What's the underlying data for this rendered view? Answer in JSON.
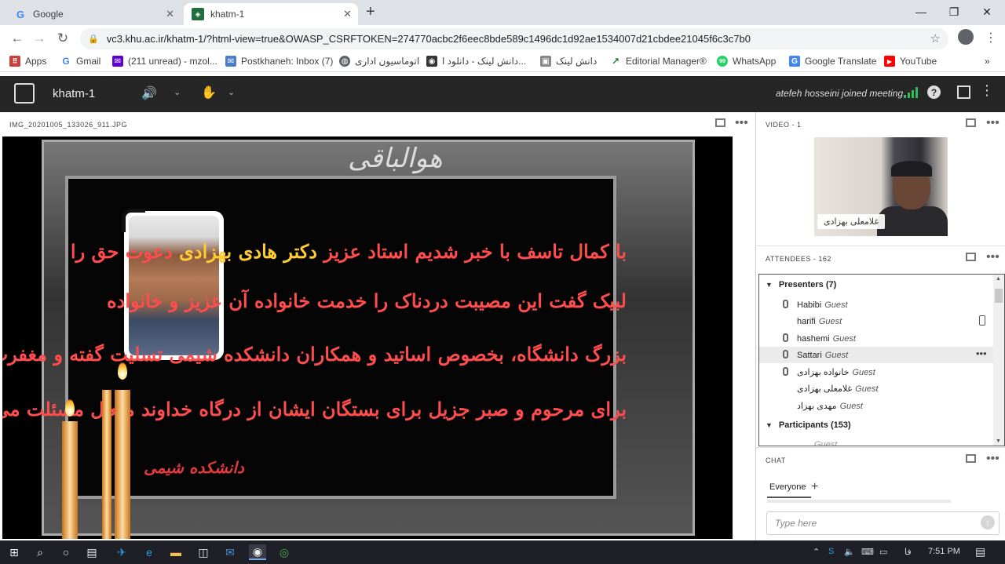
{
  "browser": {
    "tabs": [
      {
        "title": "Google",
        "favicon": "google-g-icon",
        "active": false
      },
      {
        "title": "khatm-1",
        "favicon": "adobe-connect-icon",
        "active": true
      }
    ],
    "url": "vc3.khu.ac.ir/khatm-1/?html-view=true&OWASP_CSRFTOKEN=274770acbc2f6eec8bde589c1496dc1d92ae1534007d21cbdee21045f6c3c7b0",
    "bookmarks": [
      {
        "label": "Apps",
        "icon": "apps-grid-icon"
      },
      {
        "label": "Gmail",
        "icon": "google-g-icon"
      },
      {
        "label": "(211 unread) - mzol...",
        "icon": "yahoo-mail-icon"
      },
      {
        "label": "Postkhaneh: Inbox (7)",
        "icon": "mail-icon"
      },
      {
        "label": "اتوماسیون اداری",
        "icon": "globe-icon"
      },
      {
        "label": "دانش لینک - دانلود ا...",
        "icon": "owl-icon"
      },
      {
        "label": "دانش لینک",
        "icon": "image-icon"
      },
      {
        "label": "Editorial Manager®",
        "icon": "editorial-manager-icon"
      },
      {
        "label": "WhatsApp",
        "icon": "whatsapp-icon"
      },
      {
        "label": "Google Translate",
        "icon": "google-translate-icon"
      },
      {
        "label": "YouTube",
        "icon": "youtube-icon"
      }
    ],
    "more_bookmarks": "»"
  },
  "meeting": {
    "title": "khatm-1",
    "status": "atefeh hosseini joined meeting",
    "colors": {
      "accent_green": "#2fbf5a",
      "header_bg": "#262626"
    }
  },
  "share_pod": {
    "title": "IMG_20201005_133026_911.JPG",
    "image": {
      "heading": "هوالباقی",
      "lines": [
        "با کمال تاسف با خبر شدیم استاد عزیز دکتر هادی بهزادی دعوت حق را",
        "لبیک گفت این مصیبت دردناک را خدمت خانواده آن عزیز و خانواده",
        "بزرگ دانشگاه، بخصوص اساتید و همکاران دانشکده شیمی تسلیت گفته و مغفرت",
        "برای مرحوم و صبر جزیل برای بستگان ایشان از درگاه خداوند متعال مسئلت می نماییم ."
      ],
      "highlight_name": "دکتر هادی بهزادی",
      "signature": "دانشکده شیمی"
    }
  },
  "video_pod": {
    "title": "VIDEO - 1",
    "participant_name": "غلامعلی بهزادی"
  },
  "attendees_pod": {
    "title": "ATTENDEES - 162",
    "presenters_label": "Presenters (7)",
    "presenters": [
      {
        "name": "Habibi",
        "role": "Guest",
        "mic": true,
        "device": ""
      },
      {
        "name": "harifi",
        "role": "Guest",
        "mic": false,
        "device": "mobile"
      },
      {
        "name": "hashemi",
        "role": "Guest",
        "mic": true,
        "device": ""
      },
      {
        "name": "Sattari",
        "role": "Guest",
        "mic": true,
        "device": "more"
      },
      {
        "name": "خانواده بهزادی",
        "role": "Guest",
        "mic": true,
        "device": ""
      },
      {
        "name": "غلامعلی بهزادی",
        "role": "Guest",
        "mic": false,
        "device": ""
      },
      {
        "name": "مهدی بهزاد",
        "role": "Guest",
        "mic": false,
        "device": ""
      }
    ],
    "participants_label": "Participants (153)",
    "partial_row": "Guest"
  },
  "chat_pod": {
    "title": "CHAT",
    "tab": "Everyone",
    "placeholder": "Type here"
  },
  "taskbar": {
    "lang": "فا",
    "time": "7:51 PM"
  }
}
